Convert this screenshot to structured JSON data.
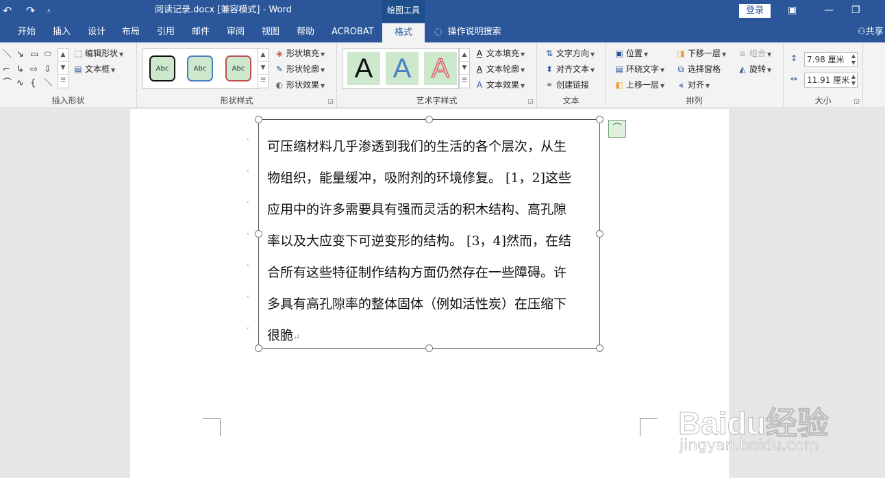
{
  "titlebar": {
    "undo": "↶",
    "redo": "↷",
    "customize": "⩡",
    "title": "阅读记录.docx [兼容模式]  -  Word",
    "context_tool": "绘图工具",
    "login": "登录",
    "restore_ribbon": "▣",
    "restore": "❐",
    "minimize": "—"
  },
  "tabs": [
    "开始",
    "插入",
    "设计",
    "布局",
    "引用",
    "邮件",
    "审阅",
    "视图",
    "帮助",
    "ACROBAT",
    "格式"
  ],
  "active_tab": "格式",
  "tell_me": "操作说明搜索",
  "share": "共享",
  "ribbon": {
    "insert_shapes": {
      "label": "插入形状",
      "edit_shape": "编辑形状",
      "text_box": "文本框"
    },
    "shape_styles": {
      "label": "形状样式",
      "swatch_text": "Abc",
      "fill": "形状填充",
      "outline": "形状轮廓",
      "effects": "形状效果"
    },
    "wordart_styles": {
      "label": "艺术字样式",
      "letter": "A",
      "text_fill": "文本填充",
      "text_outline": "文本轮廓",
      "text_effects": "文本效果"
    },
    "text": {
      "label": "文本",
      "direction": "文字方向",
      "align": "对齐文本",
      "link": "创建链接"
    },
    "arrange": {
      "label": "排列",
      "position": "位置",
      "wrap": "环绕文字",
      "forward": "上移一层",
      "backward": "下移一层",
      "selection_pane": "选择窗格",
      "align": "对齐",
      "group": "组合",
      "rotate": "旋转"
    },
    "size": {
      "label": "大小",
      "height": "7.98 厘米",
      "width": "11.91 厘米"
    }
  },
  "document": {
    "lines": [
      "可压缩材料几乎渗透到我们的生活的各个层次，从生",
      "物组织，能量缓冲，吸附剂的环境修复。 [1，2]这些",
      "应用中的许多需要具有强而灵活的积木结构、高孔隙",
      "率以及大应变下可逆变形的结构。 [3，4]然而，在结",
      "合所有这些特征制作结构方面仍然存在一些障碍。许",
      "多具有高孔隙率的整体固体（例如活性炭）在压缩下",
      "很脆"
    ],
    "return_mark": "↵"
  },
  "watermark": {
    "brand": "Baidu经验",
    "url": "jingyan.baidu.com"
  },
  "colors": {
    "accent": "#2b579a",
    "ribbon_bg": "#f3f3f3",
    "canvas_bg": "#e6e6e6"
  }
}
